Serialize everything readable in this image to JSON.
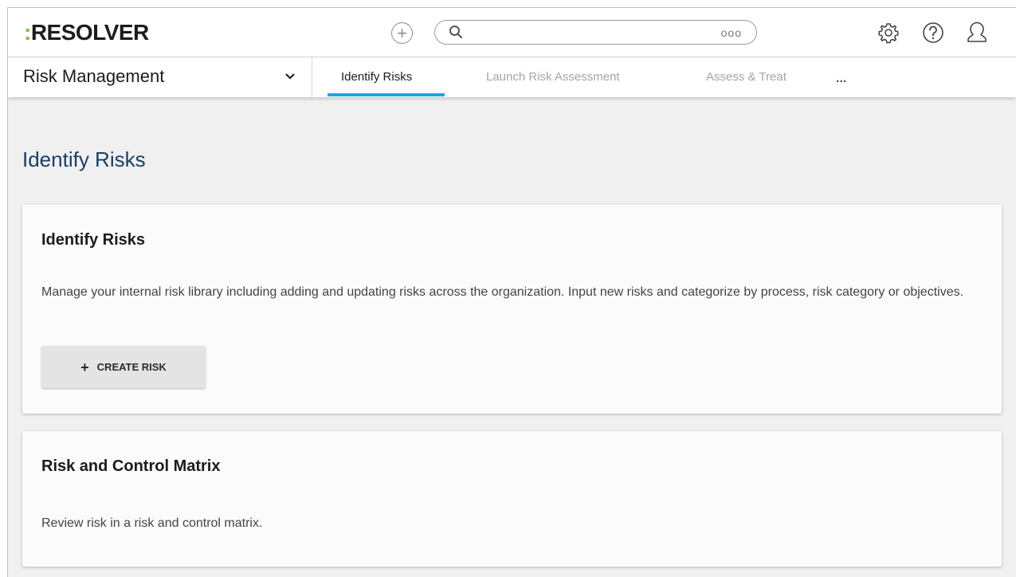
{
  "header": {
    "logo_colon": ":",
    "logo_text": "RESOLVER",
    "add_icon": "plus-circle-icon",
    "search": {
      "placeholder": "",
      "icon": "search-icon",
      "more_label": "ooo"
    },
    "settings_icon": "gear-icon",
    "help_icon": "help-circle-icon",
    "profile_icon": "user-icon"
  },
  "nav": {
    "app_name": "Risk Management",
    "tabs": [
      {
        "label": "Identify Risks",
        "active": true
      },
      {
        "label": "Launch Risk Assessment",
        "active": false
      },
      {
        "label": "Assess & Treat",
        "active": false
      }
    ],
    "more_label": "..."
  },
  "main": {
    "title": "Identify Risks",
    "cards": [
      {
        "title": "Identify Risks",
        "description": "Manage your internal risk library including adding and updating risks across the organization. Input new risks and categorize by process, risk category or objectives.",
        "button_label": "CREATE RISK"
      },
      {
        "title": "Risk and Control Matrix",
        "description": "Review risk in a risk and control matrix."
      }
    ]
  },
  "colors": {
    "accent": "#1aa8e0",
    "logo_colon": "#7bbd3a",
    "title": "#1d3e63"
  }
}
